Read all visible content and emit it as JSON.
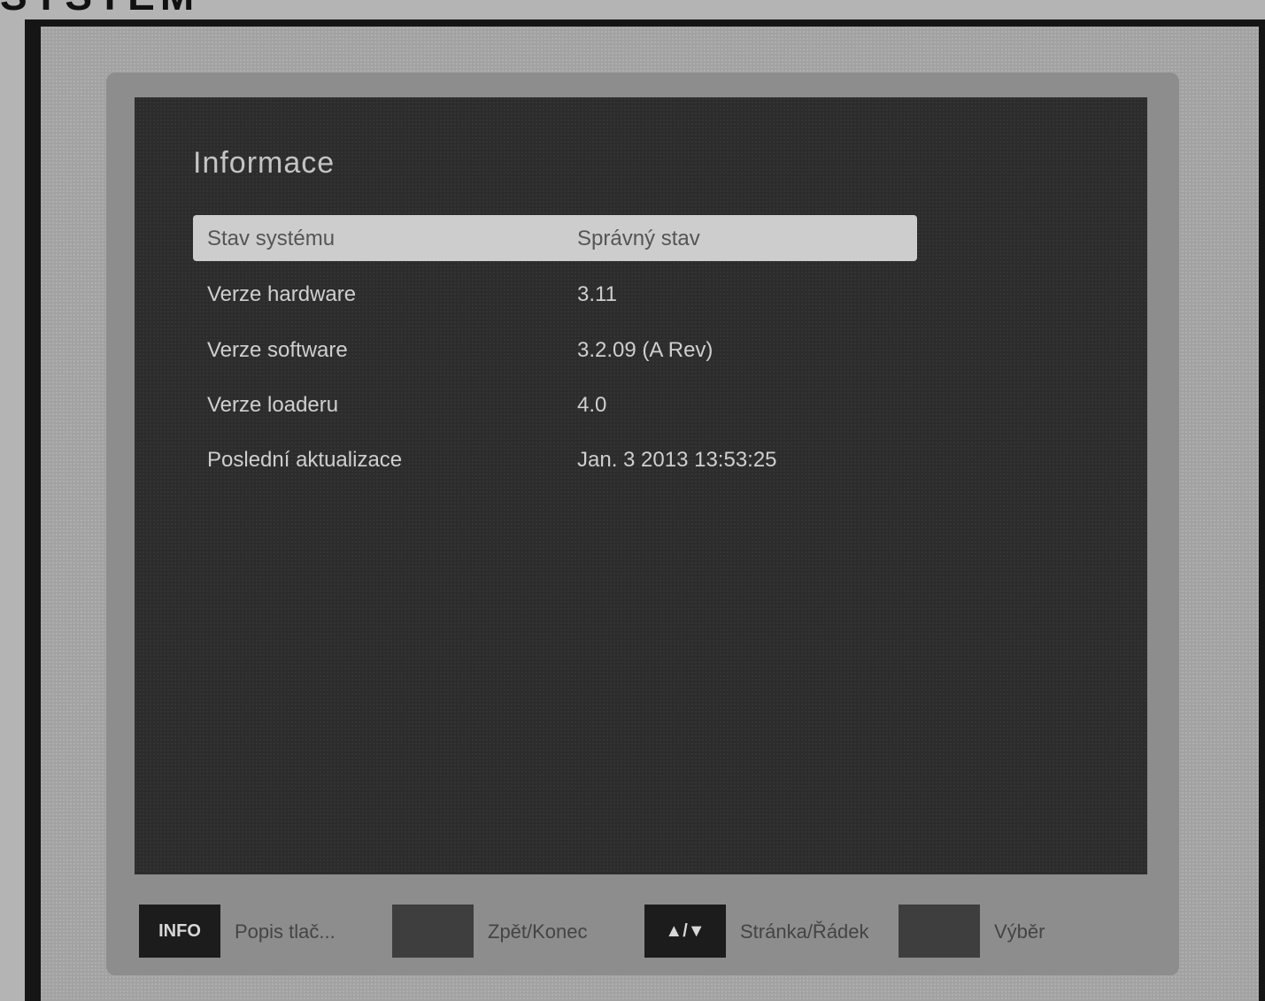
{
  "page": {
    "heading": "SYSTEM"
  },
  "dialog": {
    "title": "Informace",
    "rows": [
      {
        "label": "Stav systému",
        "value": "Správný stav",
        "selected": true
      },
      {
        "label": "Verze hardware",
        "value": "3.11",
        "selected": false
      },
      {
        "label": "Verze software",
        "value": "3.2.09 (A Rev)",
        "selected": false
      },
      {
        "label": "Verze loaderu",
        "value": "4.0",
        "selected": false
      },
      {
        "label": "Poslední aktualizace",
        "value": "Jan. 3 2013  13:53:25",
        "selected": false
      }
    ]
  },
  "footer": {
    "buttons": [
      {
        "key": "INFO",
        "label": "Popis tlač..."
      },
      {
        "key": "",
        "label": "Zpět/Konec"
      },
      {
        "key": "▲/▼",
        "label": "Stránka/Řádek"
      },
      {
        "key": "",
        "label": "Výběr"
      }
    ]
  }
}
